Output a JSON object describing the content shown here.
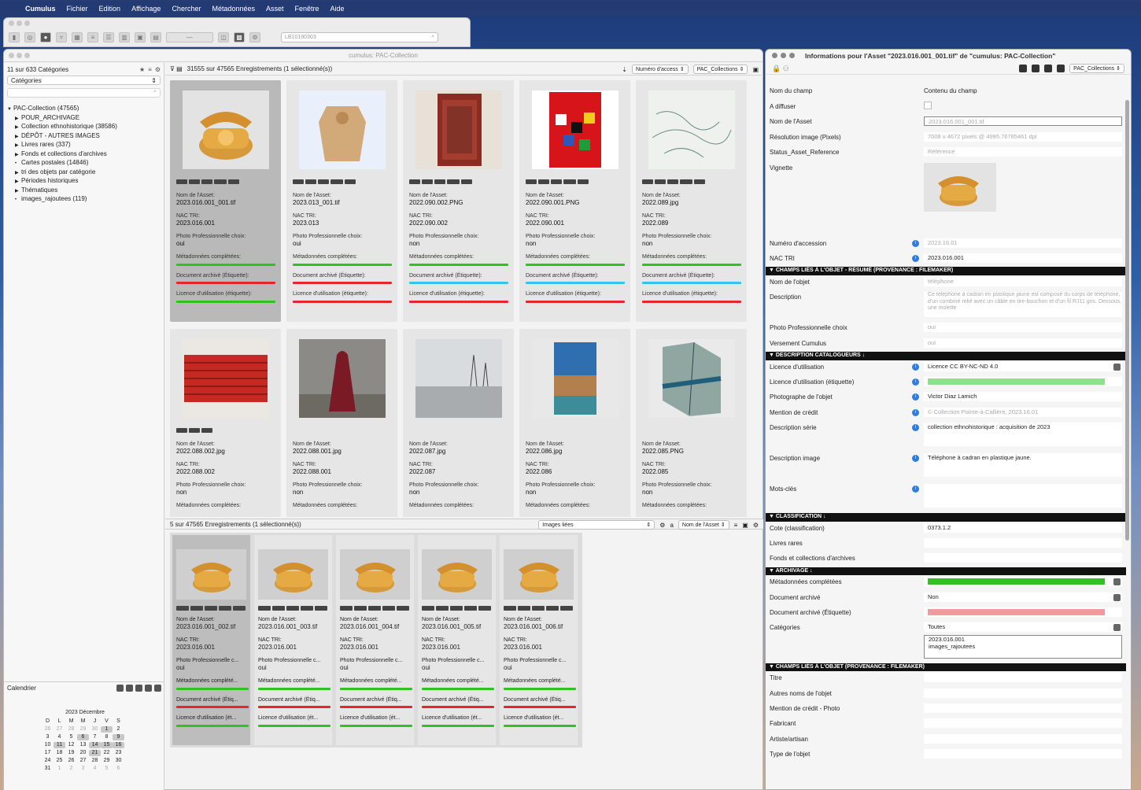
{
  "menubar": {
    "items": [
      "Cumulus",
      "Fichier",
      "Edition",
      "Affichage",
      "Chercher",
      "Métadonnées",
      "Asset",
      "Fenêtre",
      "Aide"
    ]
  },
  "toolbar": {
    "search_value": "LB10190303"
  },
  "main_window": {
    "title": "cumulus: PAC-Collection"
  },
  "left_panel": {
    "count_label": "11 sur 633 Catégories",
    "select_value": "Catégories",
    "tree": [
      {
        "label": "PAC-Collection (47565)",
        "level": 0,
        "arrow": "▼"
      },
      {
        "label": "POUR_ARCHIVAGE",
        "level": 1,
        "arrow": "▶"
      },
      {
        "label": "Collection ethnohistorique (38586)",
        "level": 1,
        "arrow": "▶"
      },
      {
        "label": "DÉPÔT - AUTRES IMAGES",
        "level": 1,
        "arrow": "▶"
      },
      {
        "label": "Livres rares (337)",
        "level": 1,
        "arrow": "▶"
      },
      {
        "label": "Fonds et collections d'archives",
        "level": 1,
        "arrow": "▶"
      },
      {
        "label": "Cartes postales (14846)",
        "level": 1,
        "arrow": "•"
      },
      {
        "label": "tri des objets par catégorie",
        "level": 1,
        "arrow": "▶"
      },
      {
        "label": "Périodes historiques",
        "level": 1,
        "arrow": "▶"
      },
      {
        "label": "Thématiques",
        "level": 1,
        "arrow": "▶"
      },
      {
        "label": "images_rajoutees (119)",
        "level": 1,
        "arrow": "•"
      }
    ],
    "calendar_label": "Calendrier",
    "calendar_title": "2023 Décembre",
    "weekdays": [
      "D",
      "L",
      "M",
      "M",
      "J",
      "V",
      "S"
    ],
    "days": [
      "26",
      "27",
      "28",
      "29",
      "30",
      "1",
      "2",
      "3",
      "4",
      "5",
      "6",
      "7",
      "8",
      "9",
      "10",
      "11",
      "12",
      "13",
      "14",
      "15",
      "16",
      "17",
      "18",
      "19",
      "20",
      "21",
      "22",
      "23",
      "24",
      "25",
      "26",
      "27",
      "28",
      "29",
      "30",
      "31",
      "1",
      "2",
      "3",
      "4",
      "5",
      "6"
    ]
  },
  "records": {
    "header": "31555 sur 47565 Enregistrements (1 sélectionné(s))",
    "sort_field": "Numéro d'access",
    "collection": "PAC_Collections",
    "labels": {
      "name": "Nom de l'Asset:",
      "nac": "NAC TRI:",
      "photo": "Photo Professionnelle choix:",
      "meta": "Métadonnées complétées:",
      "doc": "Document archivé (Étiquette):",
      "lic": "Licence d'utilisation (étiquette):"
    },
    "cards": [
      {
        "name": "2023.016.001_001.tif",
        "nac": "2023.016.001",
        "photo": "oui",
        "meta": "green",
        "doc": "red",
        "lic": "green",
        "thumb": "phone-icon"
      },
      {
        "name": "2023.013_001.tif",
        "nac": "2023.013",
        "photo": "oui",
        "meta": "green",
        "doc": "red",
        "lic": "red",
        "thumb": "garment-icon"
      },
      {
        "name": "2022.090.002.PNG",
        "nac": "2022.090.002",
        "photo": "non",
        "meta": "green",
        "doc": "cyan",
        "lic": "red",
        "thumb": "textile-icon"
      },
      {
        "name": "2022.090.001.PNG",
        "nac": "2022.090.001",
        "photo": "non",
        "meta": "green",
        "doc": "cyan",
        "lic": "red",
        "thumb": "beadwork-icon"
      },
      {
        "name": "2022.089.jpg",
        "nac": "2022.089",
        "photo": "non",
        "meta": "green",
        "doc": "cyan",
        "lic": "red",
        "thumb": "map-icon"
      },
      {
        "name": "2022.088.002.jpg",
        "nac": "2022.088.002",
        "photo": "non",
        "thumb": "blanket-icon"
      },
      {
        "name": "2022.088.001.jpg",
        "nac": "2022.088.001",
        "photo": "non",
        "thumb": "figure-icon"
      },
      {
        "name": "2022.087.jpg",
        "nac": "2022.087",
        "photo": "non",
        "thumb": "landscape-icon"
      },
      {
        "name": "2022.086.jpg",
        "nac": "2022.086",
        "photo": "non",
        "thumb": "painting-icon"
      },
      {
        "name": "2022.085.PNG",
        "nac": "2022.085",
        "photo": "non",
        "thumb": "folded-map-icon"
      }
    ]
  },
  "linked": {
    "header": "5 sur 47565 Enregistrements (1 sélectionné(s))",
    "view": "Images liées",
    "sort_field": "Nom de l'Asset",
    "labels": {
      "name": "Nom de l'Asset:",
      "nac": "NAC TRI:",
      "photo": "Photo Professionnelle c...",
      "meta": "Métadonnées complété...",
      "doc": "Document archivé (Étiq...",
      "lic": "Licence d'utilisation (ét..."
    },
    "cards": [
      {
        "name": "2023.016.001_002.tif",
        "nac": "2023.016.001",
        "photo": "oui"
      },
      {
        "name": "2023.016.001_003.tif",
        "nac": "2023.016.001",
        "photo": "oui"
      },
      {
        "name": "2023.016.001_004.tif",
        "nac": "2023.016.001",
        "photo": "oui"
      },
      {
        "name": "2023.016.001_005.tif",
        "nac": "2023.016.001",
        "photo": "oui"
      },
      {
        "name": "2023.016.001_006.tif",
        "nac": "2023.016.001",
        "photo": "oui"
      }
    ]
  },
  "info": {
    "title": "Informations pour l'Asset \"2023.016.001_001.tif\" de \"cumulus: PAC-Collection\"",
    "collection": "PAC_Collections",
    "col_field": "Nom du champ",
    "col_content": "Contenu du champ",
    "rows": [
      {
        "label": "A diffuser",
        "value": "",
        "kind": "check"
      },
      {
        "label": "Nom de l'Asset",
        "value": "2023.016.001_001.tif",
        "kind": "box"
      },
      {
        "label": "Résolution image (Pixels)",
        "value": "7008 x 4672 pixels @ 4995.76785461 dpi",
        "kind": "dim"
      },
      {
        "label": "Status_Asset_Reference",
        "value": "Référence",
        "kind": "dim"
      },
      {
        "label": "Vignette",
        "value": "",
        "kind": "thumb"
      },
      {
        "label": "Numéro d'accession",
        "value": "2023.16.01",
        "kind": "dim",
        "info": true
      },
      {
        "label": "NAC TRI",
        "value": "2023.016.001",
        "kind": "plain",
        "info": true
      },
      {
        "section": "▼ CHAMPS LIÉS À L'OBJET - RÉSUMÉ (PROVENANCE : FILEMAKER)"
      },
      {
        "label": "Nom de l'objet",
        "value": "téléphone",
        "kind": "dim"
      },
      {
        "label": "Description",
        "value": "Ce téléphone à cadran en plastique jaune est composé du corps de téléphone, d'un combiné relié avec un câble en tire-bouchon et d'un fil RJ11 gris. Dessous, une molette",
        "kind": "multi"
      },
      {
        "label": "Photo Professionnelle choix",
        "value": "oui",
        "kind": "dim"
      },
      {
        "label": "Versement Cumulus",
        "value": "oui",
        "kind": "dim"
      },
      {
        "section": "▼ DESCRIPTION CATALOGUEURS ↓"
      },
      {
        "label": "Licence d'utilisation",
        "value": "Licence CC BY-NC-ND 4.0",
        "kind": "select",
        "info": true
      },
      {
        "label": "Licence d'utilisation (étiquette)",
        "value": "",
        "kind": "greenbar",
        "info": true
      },
      {
        "label": "Photographe de l'objet",
        "value": "Victor Diaz Lamich",
        "kind": "plain",
        "info": true
      },
      {
        "label": "Mention de crédit",
        "value": "© Collection Pointe-à-Callière, 2023.16.01",
        "kind": "dim",
        "info": true
      },
      {
        "label": "Description série",
        "value": "collection ethnohistorique : acquisition de 2023",
        "kind": "tall",
        "info": true
      },
      {
        "label": "Description image",
        "value": "Téléphone à cadran en plastique jaune.",
        "kind": "tall",
        "info": true
      },
      {
        "label": "Mots-clés",
        "value": "",
        "kind": "tall",
        "info": true
      },
      {
        "section": "▼ CLASSIFICATION ↓"
      },
      {
        "label": "Cote (classification)",
        "value": "0373.1.2",
        "kind": "plain"
      },
      {
        "label": "Livres rares",
        "value": "",
        "kind": "plain"
      },
      {
        "label": "Fonds et collections d'archives",
        "value": "",
        "kind": "plain"
      },
      {
        "section": "▼ ARCHIVAGE ↓"
      },
      {
        "label": "Métadonnées complétées",
        "value": "",
        "kind": "greenbar2"
      },
      {
        "label": "Document archivé",
        "value": "Non",
        "kind": "select"
      },
      {
        "label": "Document archivé (Étiquette)",
        "value": "",
        "kind": "redbar"
      },
      {
        "label": "Catégories",
        "value": "Toutes",
        "kind": "select"
      },
      {
        "label": "",
        "value": "2023.016.001\nimages_rajoutees",
        "kind": "catbox"
      },
      {
        "section": "▼ CHAMPS LIÉS À L'OBJET (PROVENANCE : FILEMAKER)"
      },
      {
        "label": "Titre",
        "value": "",
        "kind": "plain"
      },
      {
        "label": "Autres noms de l'objet",
        "value": "",
        "kind": "plain"
      },
      {
        "label": "Mention de crédit - Photo",
        "value": "",
        "kind": "plain"
      },
      {
        "label": "Fabricant",
        "value": "",
        "kind": "plain"
      },
      {
        "label": "Artiste/artisan",
        "value": "",
        "kind": "plain"
      },
      {
        "label": "Type de l'objet",
        "value": "",
        "kind": "plain"
      }
    ]
  },
  "colors": {
    "green": "#30c21e",
    "red": "#e7252a",
    "cyan": "#34c2ee",
    "info_blue": "#2f7de1"
  }
}
